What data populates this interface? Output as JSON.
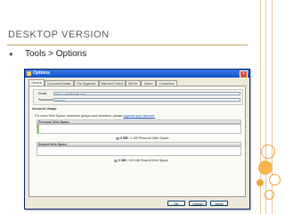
{
  "slide": {
    "title": "Desktop Version",
    "bullet": "Tools > Options"
  },
  "dialog": {
    "title": "Options",
    "tabs": [
      {
        "label": "General",
        "active": true
      },
      {
        "label": "Document Details",
        "active": false
      },
      {
        "label": "File Organizer",
        "active": false
      },
      {
        "label": "Watched Folders",
        "active": false
      },
      {
        "label": "BibTex",
        "active": false
      },
      {
        "label": "Zotero",
        "active": false
      },
      {
        "label": "Connection",
        "active": false
      }
    ],
    "account": {
      "email_label": "Email:",
      "email_value": "simon.cave@gmail.com",
      "password_label": "Password:",
      "password_value": "••••••••••"
    },
    "usage_section": {
      "title": "Account Usage",
      "note_text": "For more Web Space, restricted groups and members, please",
      "note_link": "upgrade your account.",
      "personal": {
        "title": "Personal Web Space",
        "used": "2 MB",
        "total": "/ 1 GB Personal Web Space",
        "fill_fraction": 0.01
      },
      "shared": {
        "title": "Shared Web Space",
        "used": "0 MB",
        "total": "/ 100 MB Shared Web Space",
        "fill_fraction": 0.0
      }
    },
    "buttons": {
      "ok": "OK",
      "cancel": "Cancel",
      "apply": "Apply"
    }
  },
  "colors": {
    "accent_orange": "#f0a030",
    "accent_blue": "#1552c9"
  }
}
